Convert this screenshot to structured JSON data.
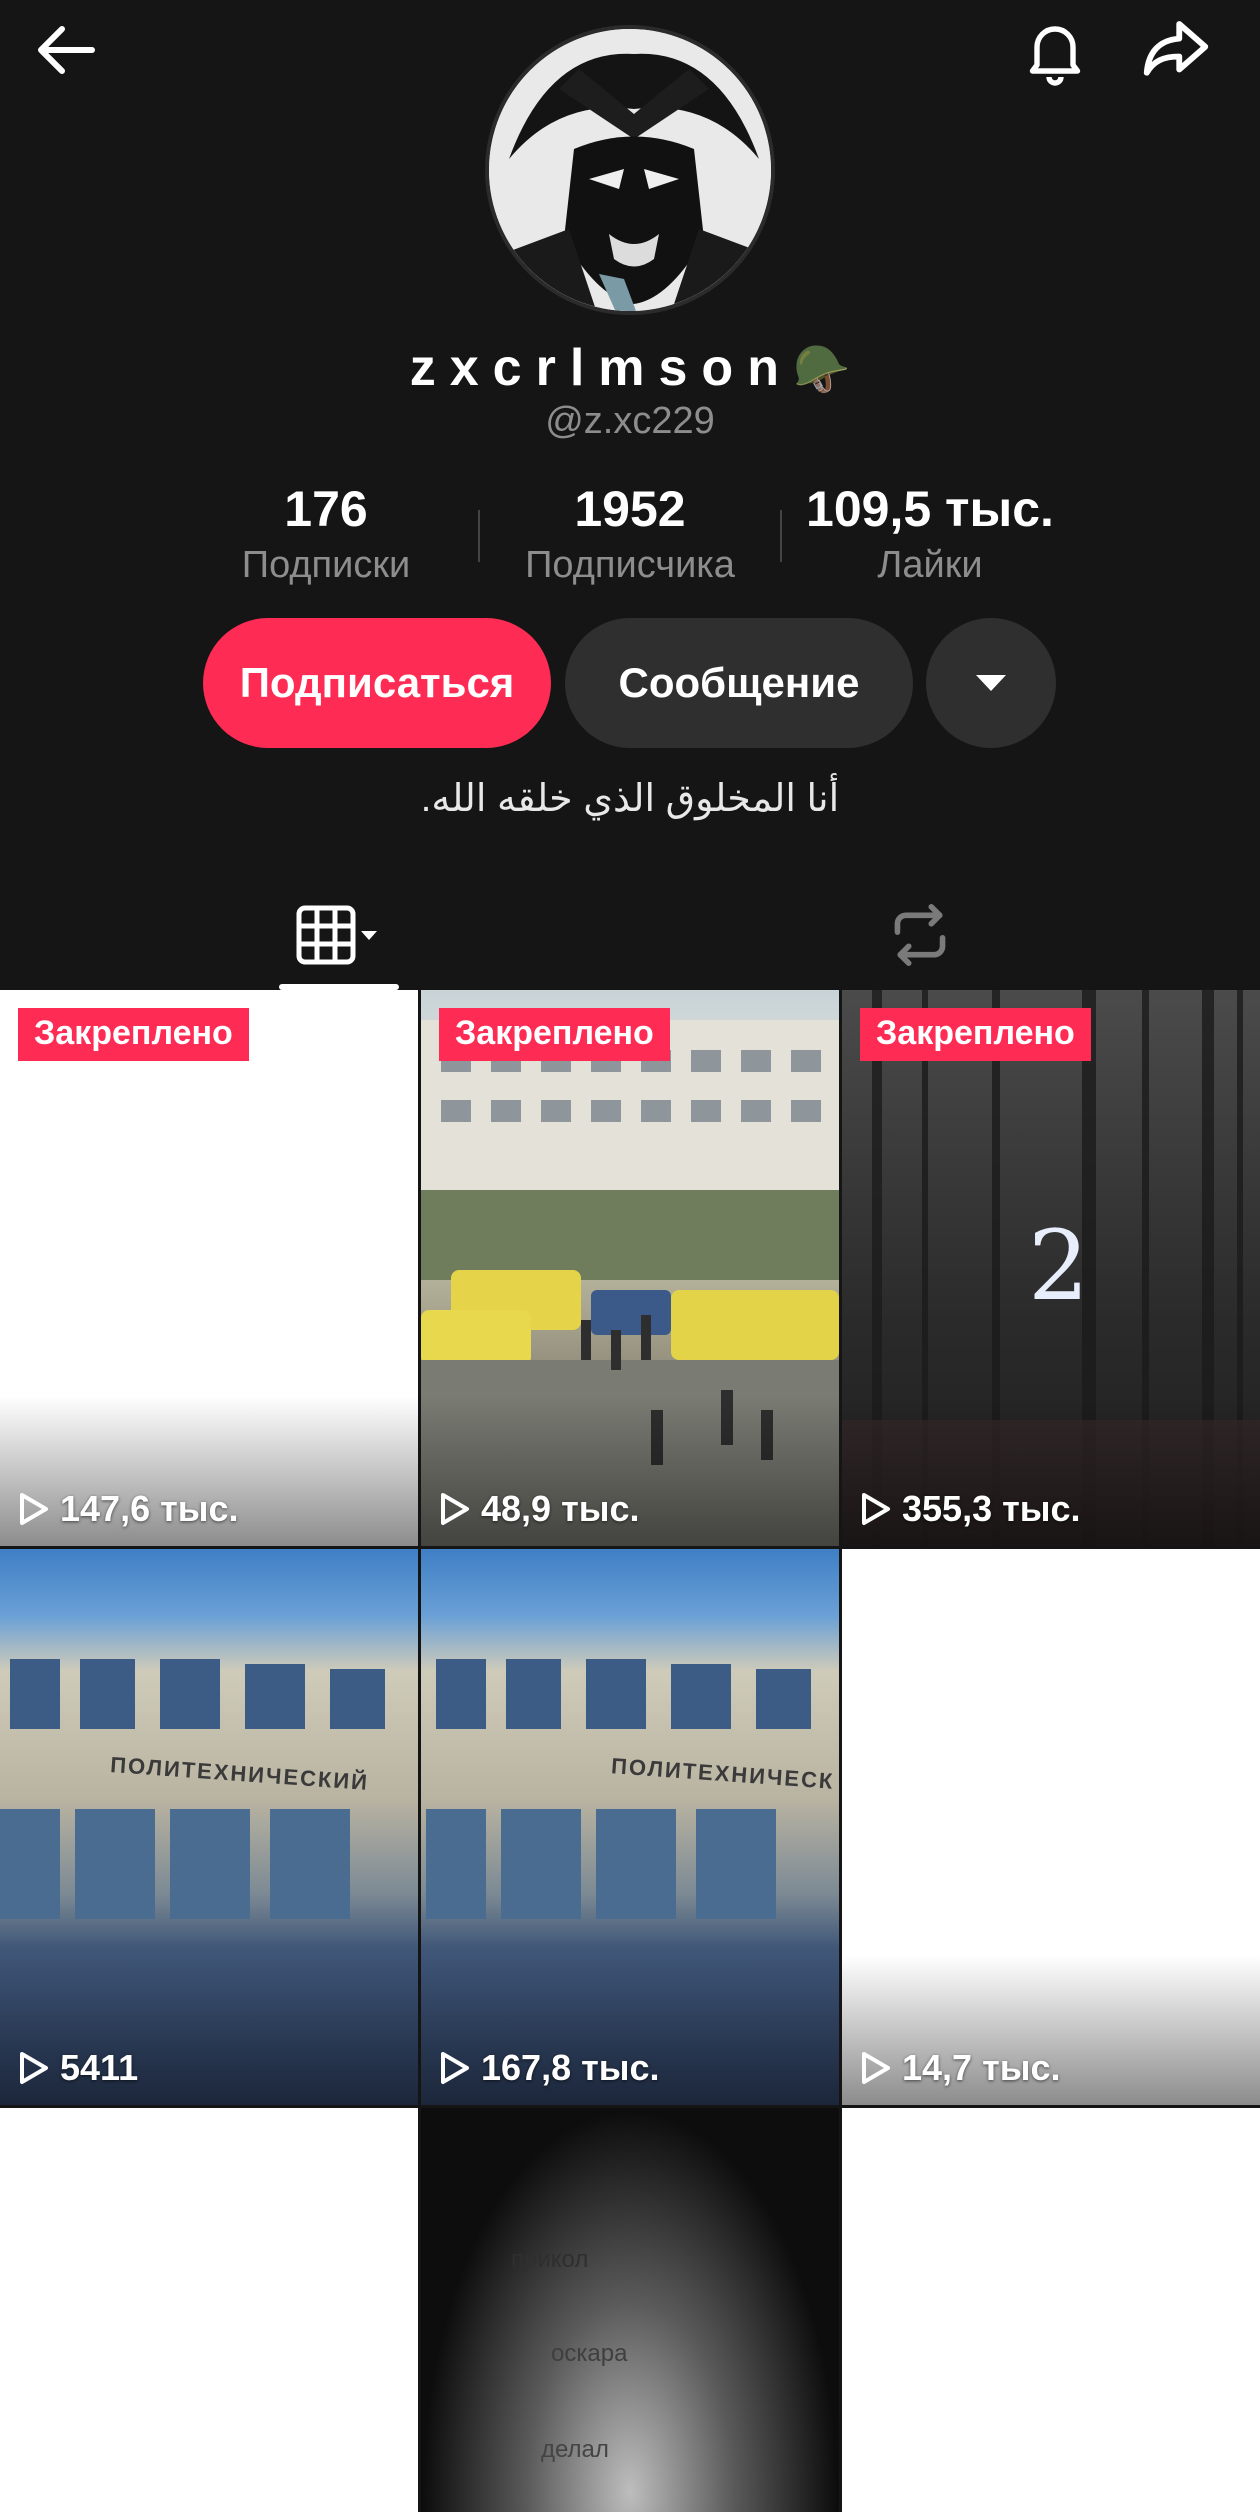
{
  "profile": {
    "username": "zxcrlmson",
    "username_emoji": "🪖",
    "handle": "@z.xc229",
    "bio": "أنا المخلوق الذي خلقه الله."
  },
  "stats": [
    {
      "value": "176",
      "label": "Подписки"
    },
    {
      "value": "1952",
      "label": "Подписчика"
    },
    {
      "value": "109,5 тыс.",
      "label": "Лайки"
    }
  ],
  "actions": {
    "follow_label": "Подписаться",
    "message_label": "Сообщение"
  },
  "colors": {
    "accent": "#fe2c55",
    "background": "#151515",
    "secondary_button": "#2f2f2f"
  },
  "icons": {
    "back": "arrow-left-icon",
    "bell": "bell-icon",
    "share": "share-arrow-icon",
    "more": "caret-down-icon",
    "grid": "grid-icon",
    "repost": "repost-icon",
    "play": "play-icon"
  },
  "videos": [
    {
      "badge": "Закреплено",
      "views": "147,6 тыс."
    },
    {
      "badge": "Закреплено",
      "views": "48,9 тыс."
    },
    {
      "badge": "Закреплено",
      "views": "355,3 тыс.",
      "overlay_text": "2"
    },
    {
      "views": "5411",
      "overlay_text": "ПОЛИТЕХНИЧЕСКИЙ"
    },
    {
      "views": "167,8 тыс.",
      "overlay_text": "ПОЛИТЕХНИЧЕСК"
    },
    {
      "views": "14,7 тыс."
    },
    {},
    {
      "overlay_lines": [
        "прикол",
        "оскара",
        "делал"
      ]
    },
    {}
  ]
}
